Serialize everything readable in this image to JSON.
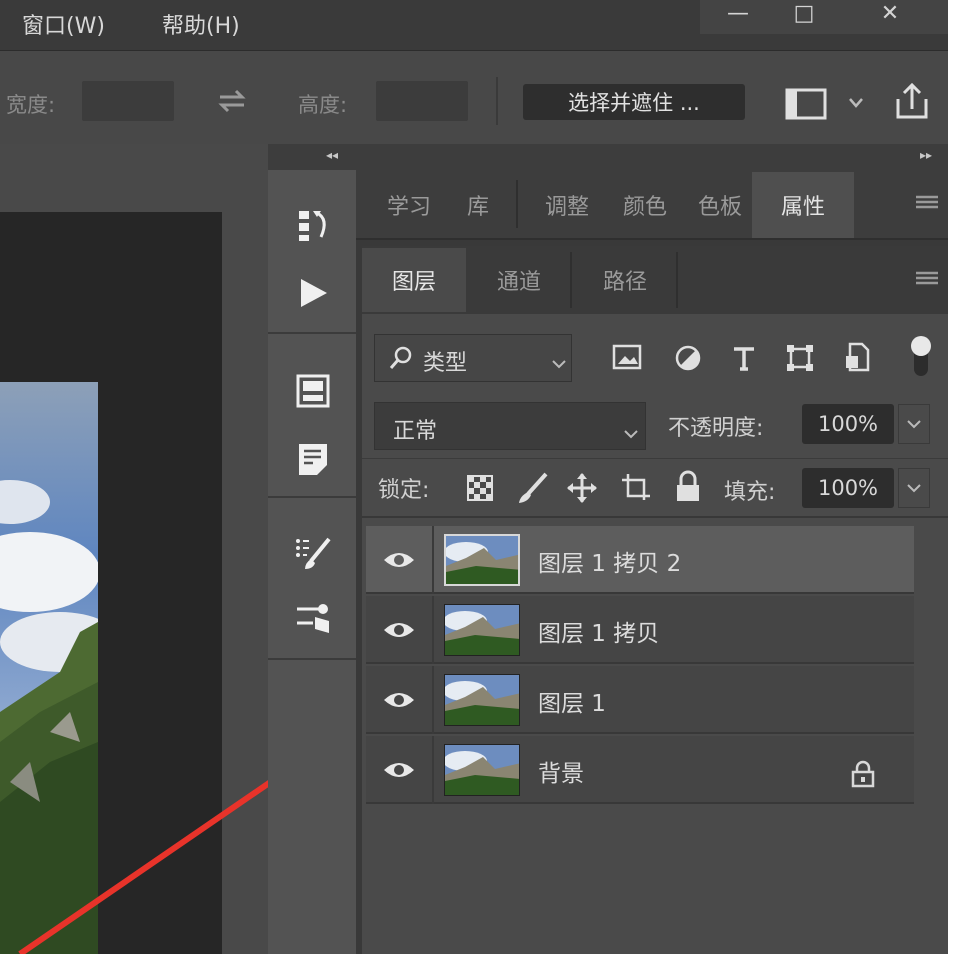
{
  "menubar": {
    "items": [
      "窗口(W)",
      "帮助(H)"
    ],
    "minimize": "—",
    "restore": "□",
    "close": "✕"
  },
  "options": {
    "width_label": "宽度:",
    "height_label": "高度:",
    "select_mask": "选择并遮住 ..."
  },
  "panel_tabs_top": [
    "学习",
    "库",
    "调整",
    "颜色",
    "色板",
    "属性"
  ],
  "panel_tabs_layers": [
    "图层",
    "通道",
    "路径"
  ],
  "layers_panel": {
    "filter_kind": "类型",
    "blend_mode": "正常",
    "opacity_label": "不透明度:",
    "opacity_value": "100%",
    "lock_label": "锁定:",
    "fill_label": "填充:",
    "fill_value": "100%",
    "layers": [
      {
        "name": "图层 1 拷贝 2",
        "selected": true,
        "locked": false
      },
      {
        "name": "图层 1 拷贝",
        "selected": false,
        "locked": false
      },
      {
        "name": "图层 1",
        "selected": false,
        "locked": false
      },
      {
        "name": "背景",
        "selected": false,
        "locked": true
      }
    ]
  },
  "colors": {
    "arrow": "#e8332a"
  }
}
